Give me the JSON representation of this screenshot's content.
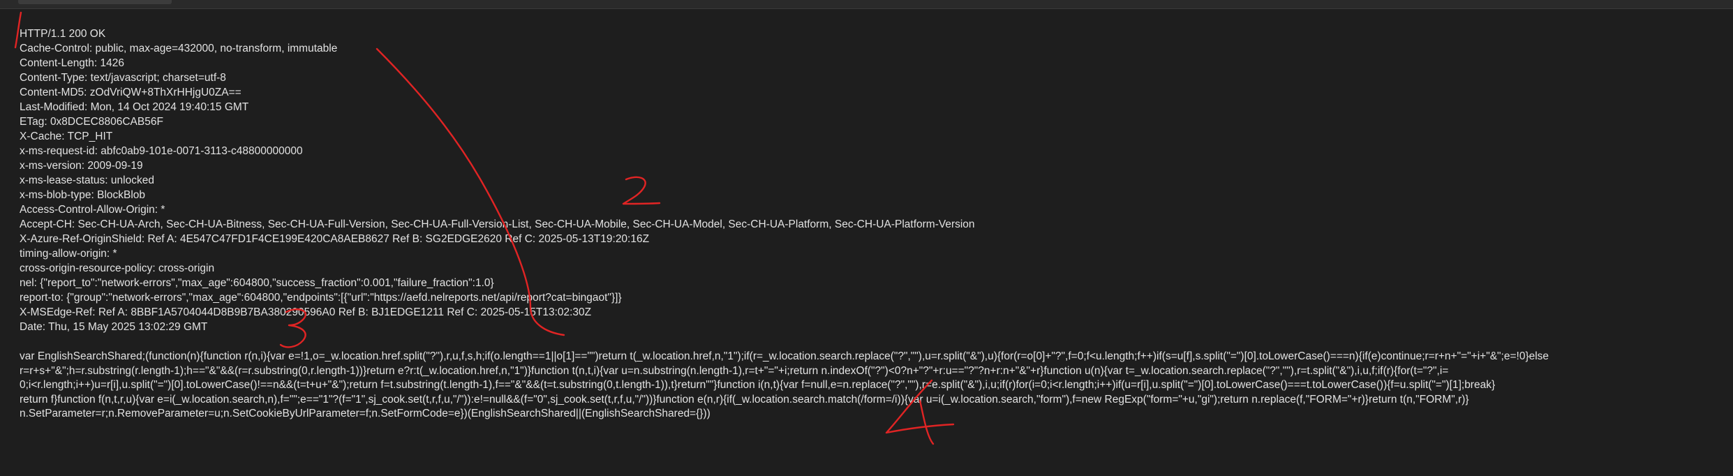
{
  "response": {
    "headers": [
      "HTTP/1.1 200 OK",
      "Cache-Control: public, max-age=432000, no-transform, immutable",
      "Content-Length: 1426",
      "Content-Type: text/javascript; charset=utf-8",
      "Content-MD5: zOdVriQW+8ThXrHHjgU0ZA==",
      "Last-Modified: Mon, 14 Oct 2024 19:40:15 GMT",
      "ETag: 0x8DCEC8806CAB56F",
      "X-Cache: TCP_HIT",
      "x-ms-request-id: abfc0ab9-101e-0071-3113-c48800000000",
      "x-ms-version: 2009-09-19",
      "x-ms-lease-status: unlocked",
      "x-ms-blob-type: BlockBlob",
      "Access-Control-Allow-Origin: *",
      "Accept-CH: Sec-CH-UA-Arch, Sec-CH-UA-Bitness, Sec-CH-UA-Full-Version, Sec-CH-UA-Full-Version-List, Sec-CH-UA-Mobile, Sec-CH-UA-Model, Sec-CH-UA-Platform, Sec-CH-UA-Platform-Version",
      "X-Azure-Ref-OriginShield: Ref A: 4E547C47FD1F4CE199E420CA8AEB8627 Ref B: SG2EDGE2620 Ref C: 2025-05-13T19:20:16Z",
      "timing-allow-origin: *",
      "cross-origin-resource-policy: cross-origin",
      "nel: {\"report_to\":\"network-errors\",\"max_age\":604800,\"success_fraction\":0.001,\"failure_fraction\":1.0}",
      "report-to: {\"group\":\"network-errors\",\"max_age\":604800,\"endpoints\":[{\"url\":\"https://aefd.nelreports.net/api/report?cat=bingaot\"}]}",
      "X-MSEdge-Ref: Ref A: 8BBF1A5704044D8B9B7BA380290596A0 Ref B: BJ1EDGE1211 Ref C: 2025-05-15T13:02:30Z",
      "Date: Thu, 15 May 2025 13:02:29 GMT"
    ],
    "body_lines": [
      "var EnglishSearchShared;(function(n){function r(n,i){var e=!1,o=_w.location.href.split(\"?\"),r,u,f,s,h;if(o.length==1||o[1]==\"\")return t(_w.location.href,n,\"1\");if(r=_w.location.search.replace(\"?\",\"\"),u=r.split(\"&\"),u){for(r=o[0]+\"?\",f=0;f<u.length;f++)if(s=u[f],s.split(\"=\")[0].toLowerCase()===n){if(e)continue;r=r+n+\"=\"+i+\"&\";e=!0}else",
      "r=r+s+\"&\";h=r.substring(r.length-1);h==\"&\"&&(r=r.substring(0,r.length-1))}return e?r:t(_w.location.href,n,\"1\")}function t(n,t,i){var u=n.substring(n.length-1),r=t+\"=\"+i;return n.indexOf(\"?\")<0?n+\"?\"+r:u==\"?\"?n+r:n+\"&\"+r}function u(n){var t=_w.location.search.replace(\"?\",\"\"),r=t.split(\"&\"),i,u,f;if(r){for(t=\"?\",i=",
      "0;i<r.length;i++)u=r[i],u.split(\"=\")[0].toLowerCase()!==n&&(t=t+u+\"&\");return f=t.substring(t.length-1),f==\"&\"&&(t=t.substring(0,t.length-1)),t}return\"\"}function i(n,t){var f=null,e=n.replace(\"?\",\"\"),r=e.split(\"&\"),i,u;if(r)for(i=0;i<r.length;i++)if(u=r[i],u.split(\"=\")[0].toLowerCase()===t.toLowerCase()){f=u.split(\"=\")[1];break}",
      "return f}function f(n,t,r,u){var e=i(_w.location.search,n),f=\"\";e==\"1\"?(f=\"1\",sj_cook.set(t,r,f,u,\"/\")):e!=null&&(f=\"0\",sj_cook.set(t,r,f,u,\"/\"))}function e(n,r){if(_w.location.search.match(/form=/i)){var u=i(_w.location.search,\"form\"),f=new RegExp(\"form=\"+u,\"gi\");return n.replace(f,\"FORM=\"+r)}return t(n,\"FORM\",r)}",
      "n.SetParameter=r;n.RemoveParameter=u;n.SetCookieByUrlParameter=f;n.SetFormCode=e})(EnglishSearchShared||(EnglishSearchShared={}))"
    ]
  },
  "annotations": {
    "labels": [
      "1",
      "2",
      "3",
      "4"
    ],
    "ink_color": "#e02424"
  }
}
